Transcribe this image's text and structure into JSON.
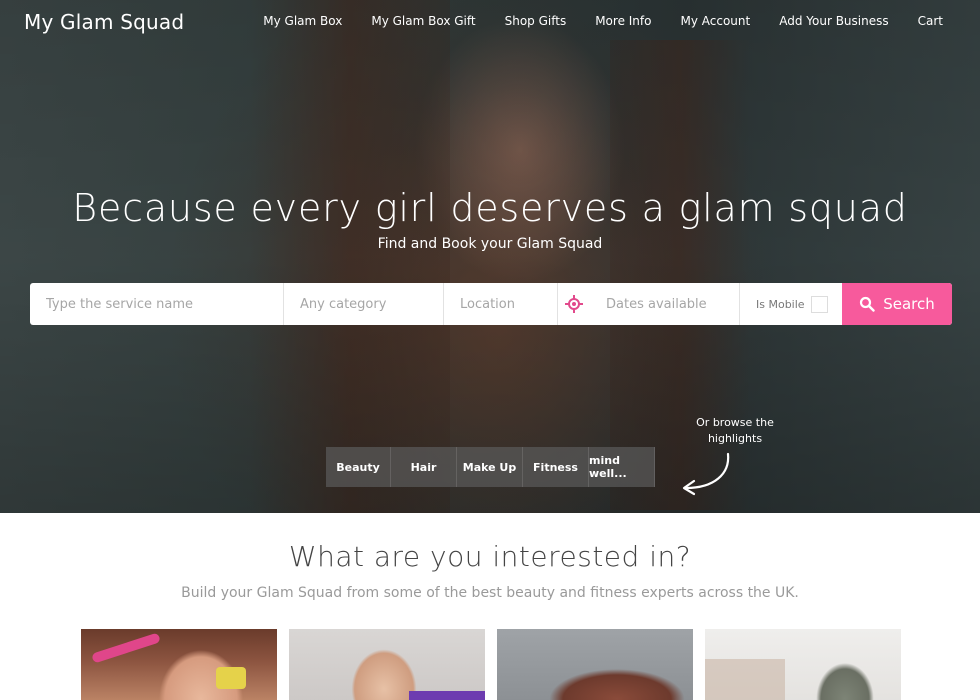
{
  "header": {
    "logo": "My Glam Squad",
    "nav": [
      "My Glam Box",
      "My Glam Box Gift",
      "Shop Gifts",
      "More Info",
      "My Account",
      "Add Your Business",
      "Cart"
    ]
  },
  "hero": {
    "headline": "Because every girl deserves a glam squad",
    "subline": "Find and Book your Glam Squad",
    "browse_hint": "Or browse the highlights",
    "categories": [
      "Beauty",
      "Hair",
      "Make Up",
      "Fitness",
      "mind well..."
    ]
  },
  "search": {
    "service_placeholder": "Type the service name",
    "category_placeholder": "Any category",
    "location_placeholder": "Location",
    "dates_placeholder": "Dates available",
    "mobile_label": "Is Mobile",
    "button_label": "Search",
    "accent_color": "#f75a9c"
  },
  "interests": {
    "title": "What are you interested in?",
    "subtitle": "Build your Glam Squad from some of the best beauty and fitness experts across the UK."
  }
}
